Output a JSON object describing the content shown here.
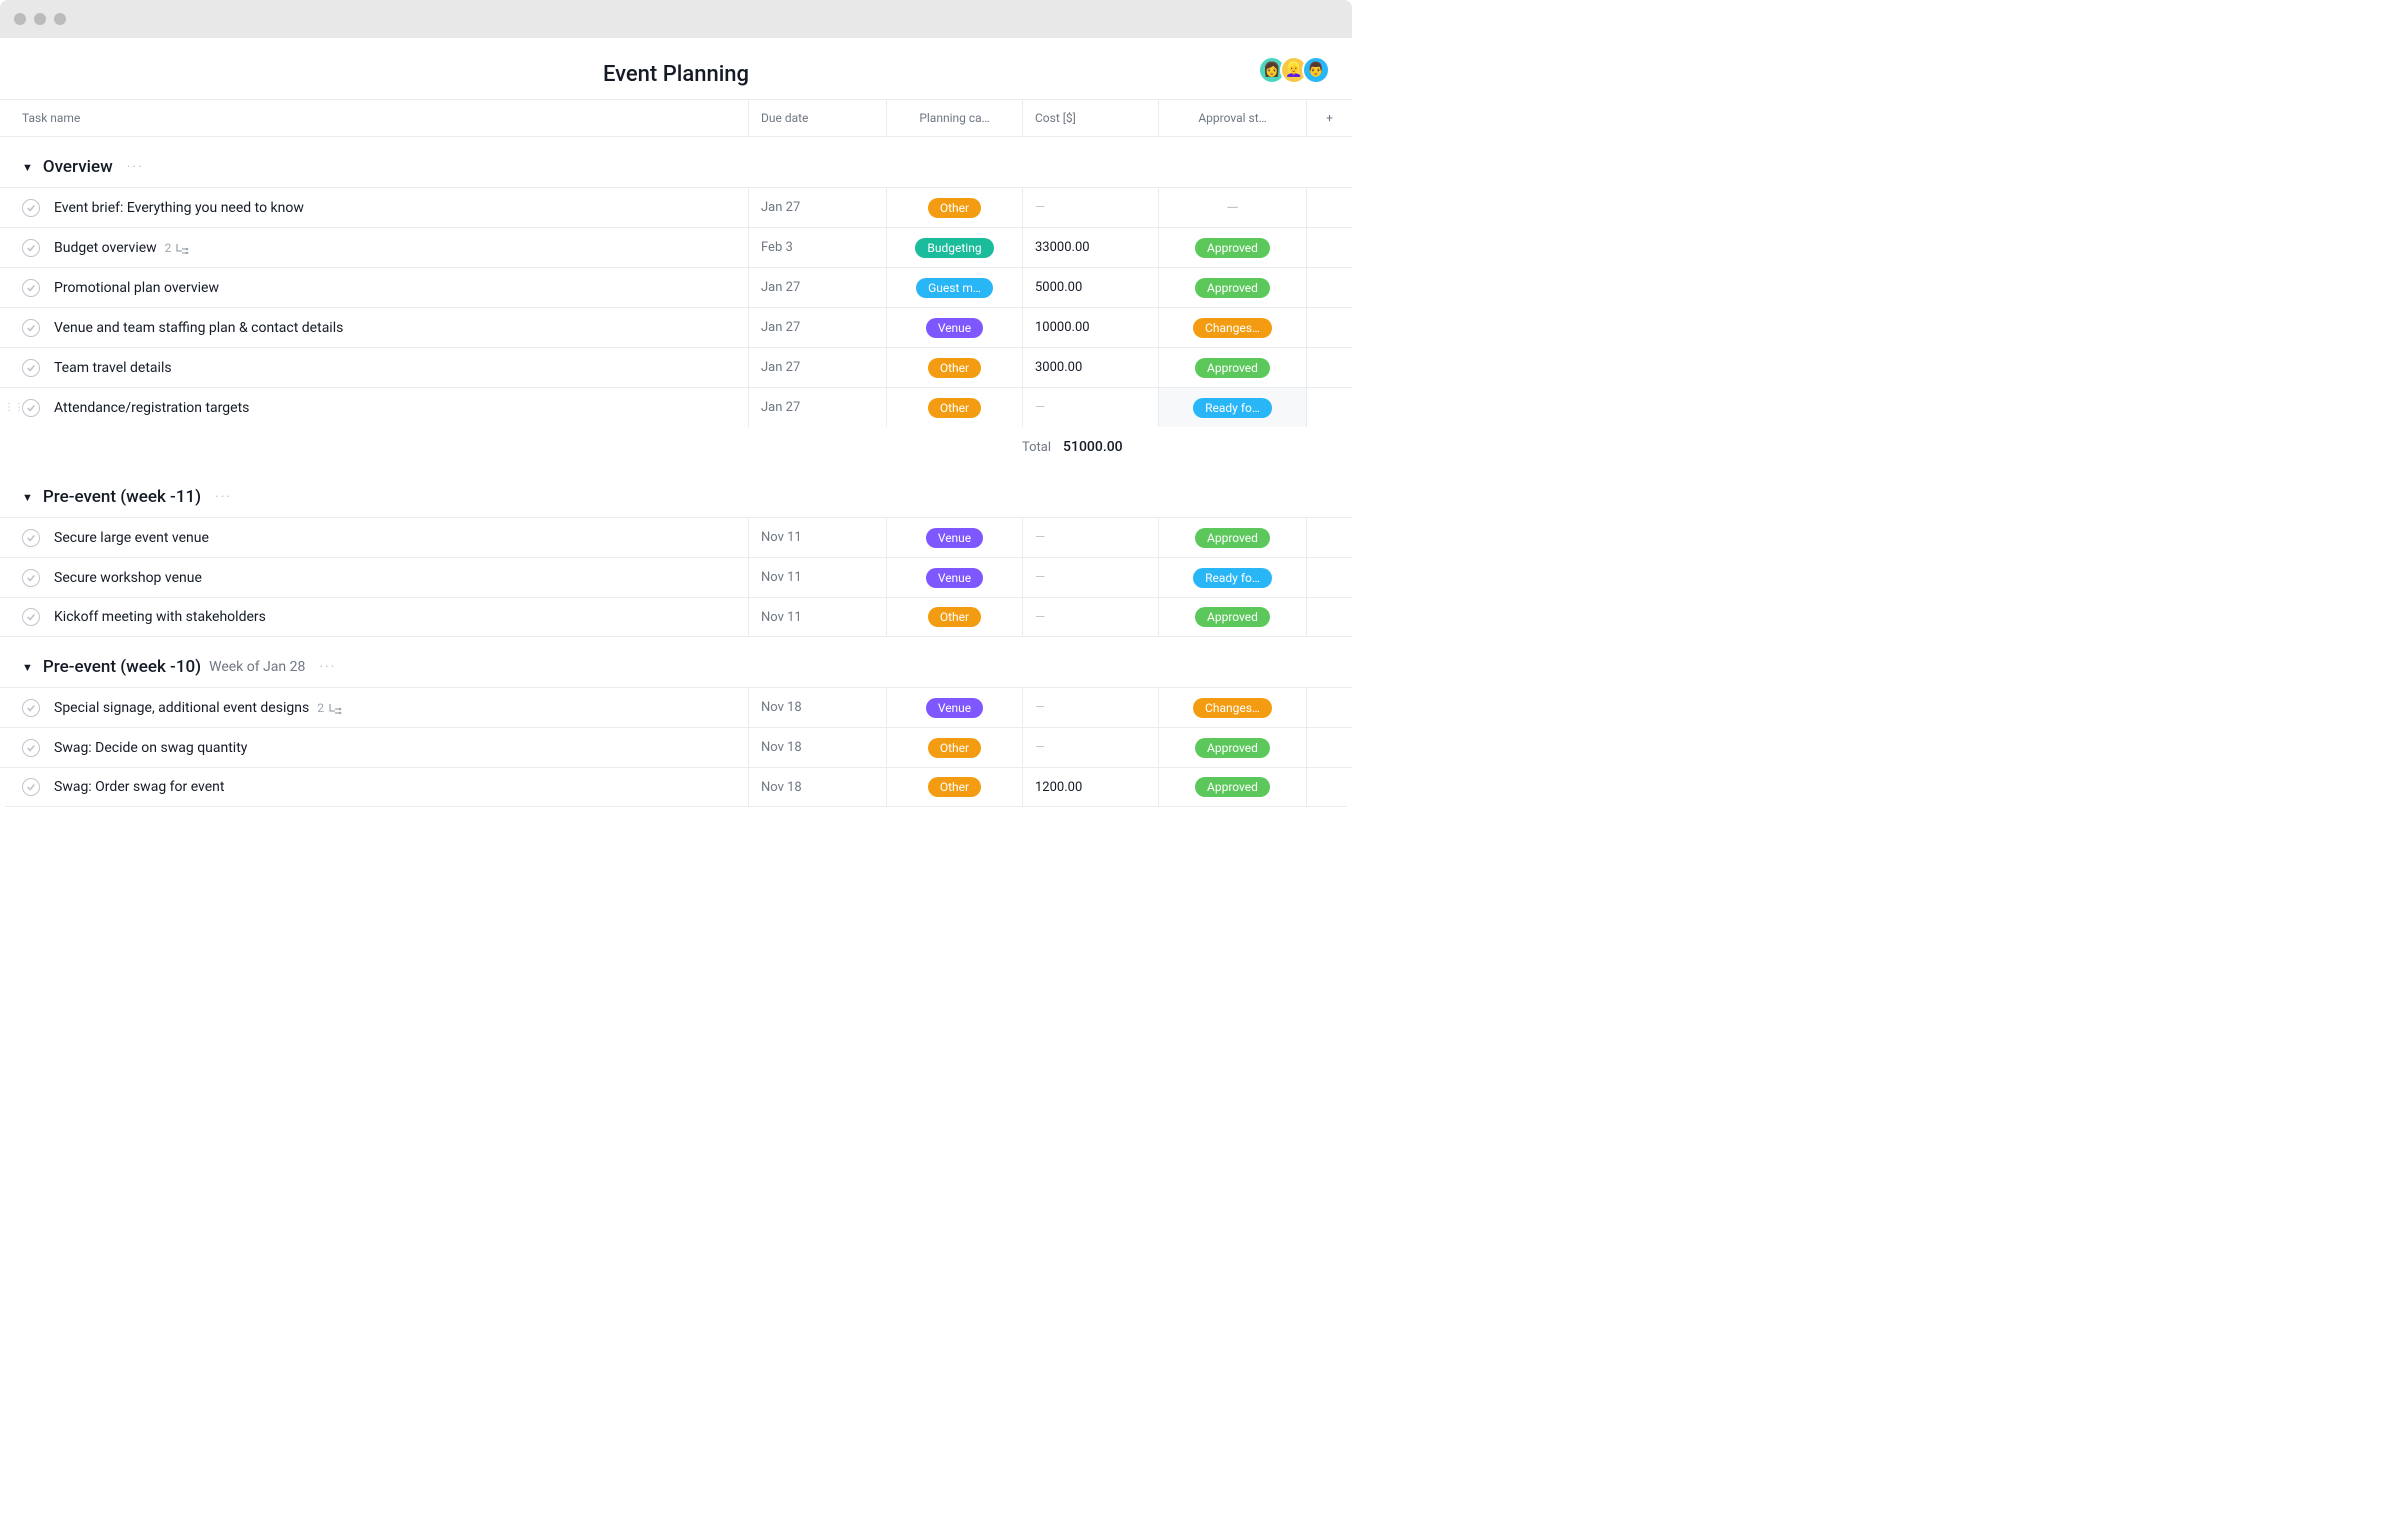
{
  "header": {
    "title": "Event Planning"
  },
  "avatars": [
    {
      "emoji": "👩"
    },
    {
      "emoji": "👱‍♀️"
    },
    {
      "emoji": "👨"
    }
  ],
  "columns": {
    "task": "Task name",
    "due": "Due date",
    "category": "Planning ca…",
    "cost": "Cost [$]",
    "status": "Approval st…",
    "plus": "+"
  },
  "category_styles": {
    "Other": "pill-other",
    "Budgeting": "pill-budgeting",
    "Guest m…": "pill-guest",
    "Venue": "pill-venue"
  },
  "status_styles": {
    "Approved": "pill-approved",
    "Changes…": "pill-changes",
    "Ready fo…": "pill-ready"
  },
  "sections": [
    {
      "title": "Overview",
      "meta": "",
      "tasks": [
        {
          "name": "Event brief: Everything you need to know",
          "due": "Jan 27",
          "category": "Other",
          "cost": "",
          "status": ""
        },
        {
          "name": "Budget overview",
          "subtasks": 2,
          "due": "Feb 3",
          "category": "Budgeting",
          "cost": "33000.00",
          "status": "Approved"
        },
        {
          "name": "Promotional plan overview",
          "due": "Jan 27",
          "category": "Guest m…",
          "cost": "5000.00",
          "status": "Approved"
        },
        {
          "name": "Venue and team staffing plan & contact details",
          "due": "Jan 27",
          "category": "Venue",
          "cost": "10000.00",
          "status": "Changes…"
        },
        {
          "name": "Team travel details",
          "due": "Jan 27",
          "category": "Other",
          "cost": "3000.00",
          "status": "Approved"
        },
        {
          "name": "Attendance/registration targets",
          "due": "Jan 27",
          "category": "Other",
          "cost": "",
          "status": "Ready fo…",
          "hovered": true
        }
      ],
      "total_label": "Total",
      "total_value": "51000.00"
    },
    {
      "title": "Pre-event (week -11)",
      "meta": "",
      "tasks": [
        {
          "name": "Secure large event venue",
          "due": "Nov 11",
          "category": "Venue",
          "cost": "",
          "status": "Approved"
        },
        {
          "name": "Secure workshop venue",
          "due": "Nov 11",
          "category": "Venue",
          "cost": "",
          "status": "Ready fo…"
        },
        {
          "name": "Kickoff meeting with stakeholders",
          "due": "Nov 11",
          "category": "Other",
          "cost": "",
          "status": "Approved"
        }
      ]
    },
    {
      "title": "Pre-event (week -10)",
      "meta": "Week of Jan 28",
      "tasks": [
        {
          "name": "Special signage, additional event designs",
          "subtasks": 2,
          "due": "Nov 18",
          "category": "Venue",
          "cost": "",
          "status": "Changes…"
        },
        {
          "name": "Swag: Decide on swag quantity",
          "due": "Nov 18",
          "category": "Other",
          "cost": "",
          "status": "Approved"
        },
        {
          "name": "Swag: Order swag for event",
          "due": "Nov 18",
          "category": "Other",
          "cost": "1200.00",
          "status": "Approved"
        }
      ]
    }
  ]
}
